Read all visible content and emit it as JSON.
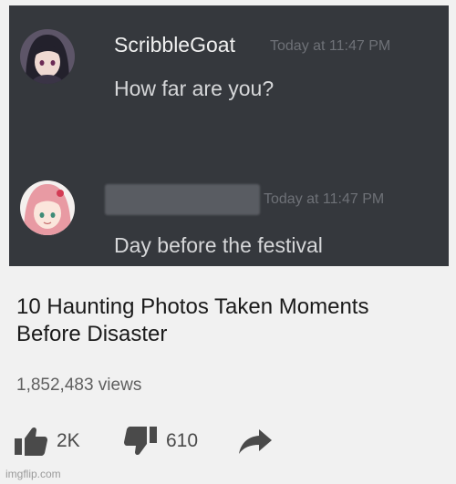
{
  "chat": {
    "messages": [
      {
        "username": "ScribbleGoat",
        "timestamp": "Today at 11:47 PM",
        "text": "How far are you?",
        "avatar_icon": "anime-girl-dark-hair-avatar"
      },
      {
        "username": "",
        "timestamp": "Today at 11:47 PM",
        "text": "Day before the festival",
        "avatar_icon": "anime-girl-pink-hair-avatar"
      }
    ],
    "colors": {
      "background": "#35383d",
      "username": "#f0f0f0",
      "timestamp": "#6e7177",
      "text": "#d6d7d9"
    }
  },
  "video": {
    "title": "10 Haunting Photos Taken Moments Before Disaster",
    "views": "1,852,483 views",
    "likes": "2K",
    "dislikes": "610",
    "icons": {
      "like": "thumbs-up-icon",
      "dislike": "thumbs-down-icon",
      "share": "share-arrow-icon"
    }
  },
  "watermark": "imgflip.com"
}
